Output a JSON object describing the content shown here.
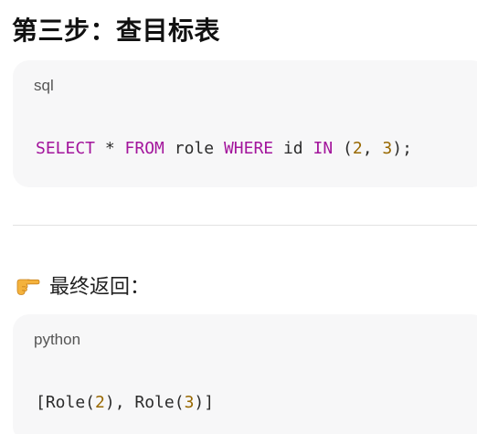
{
  "heading": "第三步：查目标表",
  "sql_block": {
    "lang": "sql",
    "tokens": {
      "select": "SELECT",
      "star": " * ",
      "from": "FROM",
      "table": " role ",
      "where": "WHERE",
      "col": " id ",
      "in": "IN",
      "open": " (",
      "n2": "2",
      "comma": ", ",
      "n3": "3",
      "close": ");"
    }
  },
  "result_label": "最终返回：",
  "python_block": {
    "lang": "python",
    "tokens": {
      "p1": "[Role(",
      "n2": "2",
      "p2": "), Role(",
      "n3": "3",
      "p3": ")]"
    }
  },
  "colors": {
    "keyword": "#a3159c",
    "number": "#986801",
    "code_bg": "#f7f7f8"
  }
}
